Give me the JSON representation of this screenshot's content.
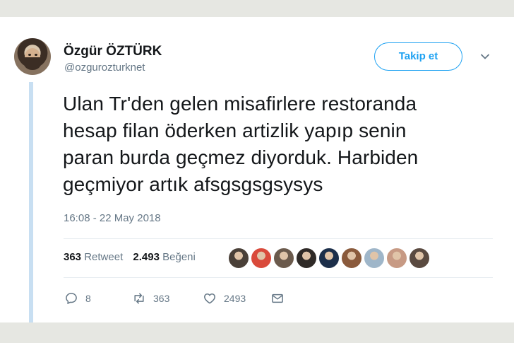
{
  "user": {
    "name": "Özgür ÖZTÜRK",
    "handle": "@ozgurozturknet"
  },
  "follow_button": {
    "label": "Takip et"
  },
  "tweet": {
    "lines": [
      "Ulan Tr'den gelen misafirlere restoranda",
      "hesap filan öderken artizlik yapıp senin",
      "paran burda geçmez diyorduk. Harbiden",
      "geçmiyor artık afsgsgsgsysys"
    ],
    "timestamp": "16:08 - 22 May 2018"
  },
  "stats": {
    "retweets_count": "363",
    "retweets_label": "Retweet",
    "likes_count": "2.493",
    "likes_label": "Beğeni"
  },
  "liker_avatars": [
    {
      "color": "#4a4038",
      "icon": "avatar"
    },
    {
      "color": "#d94a3b",
      "icon": "avatar"
    },
    {
      "color": "#6b5a4c",
      "icon": "avatar"
    },
    {
      "color": "#2f2a27",
      "icon": "avatar"
    },
    {
      "color": "#1c2f4a",
      "icon": "avatar"
    },
    {
      "color": "#8a5a3c",
      "icon": "avatar"
    },
    {
      "color": "#9fb6c9",
      "icon": "avatar"
    },
    {
      "color": "#c79a84",
      "icon": "avatar"
    },
    {
      "color": "#5a4a40",
      "icon": "avatar"
    }
  ],
  "actions": {
    "reply_count": "8",
    "retweet_count": "363",
    "like_count": "2493"
  },
  "colors": {
    "accent": "#1da1f2",
    "text": "#14171a",
    "secondary": "#657786",
    "thread_line": "#c8dff2"
  }
}
